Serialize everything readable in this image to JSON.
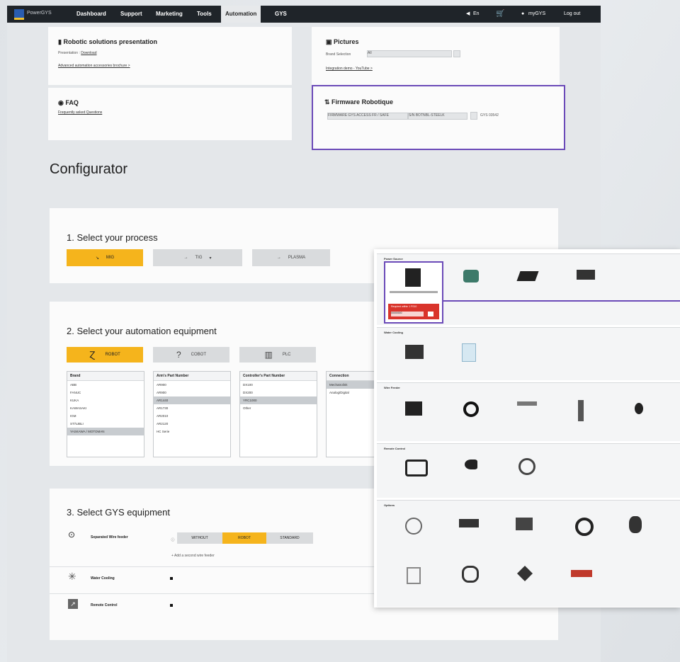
{
  "nav": {
    "logo_text": "PowerGYS",
    "items": [
      "Dashboard",
      "Support",
      "Marketing",
      "Tools",
      "Automation",
      "GYS"
    ],
    "active": "Automation",
    "lang": "En",
    "user": "myGYS",
    "logout": "Log out"
  },
  "cards": {
    "robotic": {
      "title": "Robotic solutions presentation",
      "line": "Presentation",
      "link1": "Download",
      "link2": "Advanced automation accessories brochure >"
    },
    "pictures": {
      "title": "Pictures",
      "select_label": "Brand Selection",
      "select_value": "All",
      "link": "Integration demo - YouTube >"
    },
    "faq": {
      "title": "FAQ",
      "link": "Frequently asked Questions"
    },
    "firmware": {
      "title": "Firmware Robotique",
      "select1": "FIRMWARE GYS ACCESS FR / SAFE",
      "select2": "S/N BOTNBL-STEELK",
      "code": "GYS 03542"
    }
  },
  "configurator": {
    "title": "Configurator"
  },
  "step1": {
    "title": "1. Select your process",
    "buttons": [
      "MIG",
      "TIG",
      "PLASMA"
    ],
    "active": "MIG"
  },
  "step2": {
    "title": "2. Select your automation equipment",
    "buttons": [
      "ROBOT",
      "COBOT",
      "PLC"
    ],
    "active": "ROBOT",
    "lists": [
      {
        "header": "Brand",
        "items": [
          "ABB",
          "FANUC",
          "KUKA",
          "KAWASAKI",
          "IGM",
          "STÄUBLI",
          "YASKAWA / MOTOMAN"
        ],
        "selected": 6
      },
      {
        "header": "Arm's Part Number",
        "items": [
          "AR900",
          "AR900",
          "AR1440",
          "AR1730",
          "AR2010",
          "AR2120",
          "HC Serie"
        ],
        "selected": 2
      },
      {
        "header": "Controller's Part Number",
        "items": [
          "DX100",
          "DX200",
          "YRC1000",
          "Other"
        ],
        "selected": 2
      },
      {
        "header": "Connection",
        "items": [
          "Mechatrolink",
          "Analog/Digital"
        ],
        "selected": 0
      }
    ]
  },
  "step3": {
    "title": "3. Select GYS equipment",
    "rows": [
      {
        "label": "Separated Wire feeder",
        "options": [
          "WITHOUT",
          "ROBOT",
          "STANDARD"
        ],
        "active": "ROBOT",
        "add": "+ Add a second wire feeder"
      },
      {
        "label": "Water Cooling"
      },
      {
        "label": "Remote Control"
      }
    ]
  },
  "overlay": {
    "sections": [
      "Power Source",
      "Water Cooling",
      "Wire Feeder",
      "Remote Control",
      "Options"
    ],
    "alert": "Required within 1 FS10",
    "alert_value": "00000000"
  },
  "colors": {
    "accent": "#f5b41c",
    "nav": "#1f2429",
    "highlight": "#6b4ab8",
    "alert": "#d9342b"
  }
}
